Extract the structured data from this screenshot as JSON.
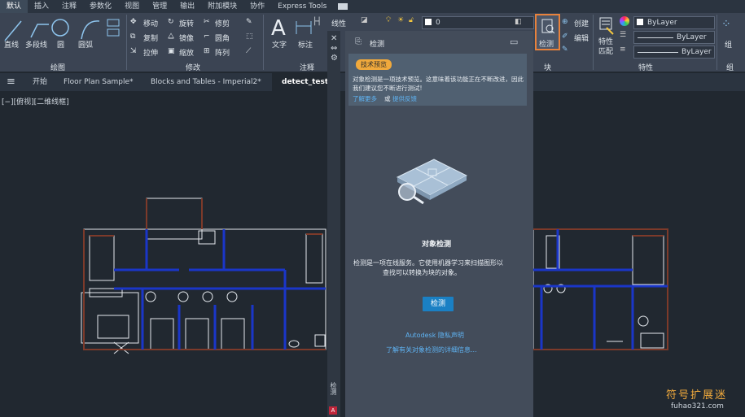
{
  "ribbon_tabs": [
    "默认",
    "插入",
    "注释",
    "参数化",
    "视图",
    "管理",
    "输出",
    "附加模块",
    "协作",
    "Express Tools"
  ],
  "draw": {
    "line": "直线",
    "polyline": "多段线",
    "circle": "圆",
    "arc": "圆弧",
    "panel": "绘图"
  },
  "modify": {
    "move": "移动",
    "rotate": "旋转",
    "trim": "修剪",
    "copy": "复制",
    "mirror": "镜像",
    "fillet": "圆角",
    "stretch": "拉伸",
    "scale": "缩放",
    "array": "阵列",
    "panel": "修改"
  },
  "annotation": {
    "text": "文字",
    "dimension": "标注",
    "linear": "线性",
    "panel": "注释"
  },
  "layer_value": "0",
  "block": {
    "detect": "检测",
    "create": "创建",
    "edit": "编辑",
    "panel": "块"
  },
  "properties": {
    "match": "特性匹配",
    "bylayer1": "ByLayer",
    "bylayer2": "ByLayer",
    "bylayer3": "ByLayer",
    "panel": "特性"
  },
  "group": {
    "label": "组"
  },
  "file_tabs": [
    "开始",
    "Floor Plan Sample*",
    "Blocks and Tables - Imperial2*",
    "detect_test*"
  ],
  "viewport_label": "[−][俯视][二维线框]",
  "palette": {
    "header": "检测",
    "badge": "技术预览",
    "notice": "对象检测是一项技术预览。这意味着该功能正在不断改进，因此我们建议您不断进行测试!",
    "learn_more": "了解更多",
    "or": "或",
    "feedback": "提供反馈",
    "title": "对象检测",
    "description1": "检测是一项在线服务。它使用机器学习来扫描图形以",
    "description2": "查找可以转换为块的对象。",
    "detect_button": "检测",
    "privacy": "Autodesk 隐私声明",
    "more_info": "了解有关对象检测的详细信息..."
  },
  "side_strip_label": "检测",
  "watermark": {
    "title": "符号扩展迷",
    "url": "fuhao321.com"
  }
}
